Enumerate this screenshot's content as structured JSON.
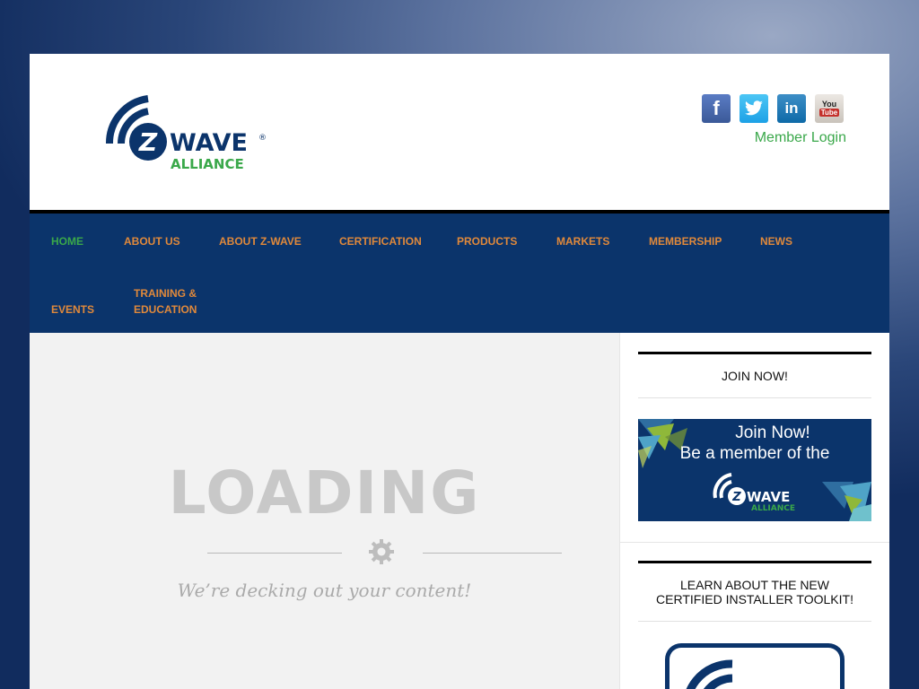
{
  "header": {
    "logo": {
      "brand": "Z",
      "wordmark": "WAVE",
      "registered": "®",
      "sub": "ALLIANCE"
    },
    "social": [
      {
        "name": "facebook",
        "glyph": "f"
      },
      {
        "name": "twitter",
        "glyph": ""
      },
      {
        "name": "linkedin",
        "glyph": "in"
      },
      {
        "name": "youtube",
        "glyph_top": "You",
        "glyph_bottom": "Tube"
      }
    ],
    "member_login": "Member Login"
  },
  "nav": {
    "items": [
      {
        "label": "HOME",
        "active": true
      },
      {
        "label": "ABOUT US"
      },
      {
        "label": "ABOUT Z-WAVE"
      },
      {
        "label": "CERTIFICATION"
      },
      {
        "label": "PRODUCTS"
      },
      {
        "label": "MARKETS"
      },
      {
        "label": "MEMBERSHIP"
      },
      {
        "label": "NEWS"
      },
      {
        "label": "EVENTS"
      },
      {
        "label_line1": "TRAINING &",
        "label_line2": "EDUCATION"
      }
    ]
  },
  "main": {
    "loading": "LOADING",
    "tagline": "We’re decking out your content!"
  },
  "sidebar": {
    "join_heading": "JOIN NOW!",
    "banner": {
      "line1": "Join Now!",
      "line2": "Be a member of the",
      "logo_word": "WAVE",
      "logo_sub": "ALLIANCE"
    },
    "toolkit_heading_line1": "LEARN ABOUT THE NEW",
    "toolkit_heading_line2": "CERTIFIED INSTALLER TOOLKIT!"
  },
  "colors": {
    "nav_bg": "#0b346b",
    "nav_link": "#e0893b",
    "nav_active": "#3aa84a",
    "member_login": "#3aa84a",
    "brand_blue": "#0b346b",
    "brand_green": "#3aa84a"
  }
}
